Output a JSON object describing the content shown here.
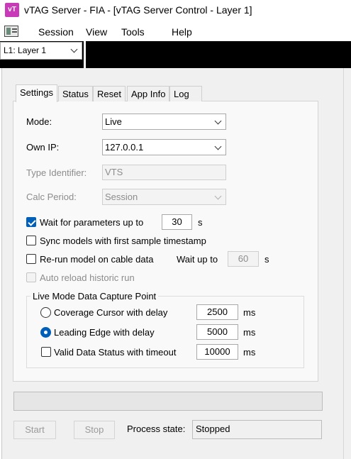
{
  "window": {
    "app_icon_text": "vT",
    "title": "vTAG Server - FIA - [vTAG Server Control - Layer 1]"
  },
  "menu": {
    "items": [
      "Session",
      "View",
      "Tools",
      "Help"
    ]
  },
  "layer_selector": {
    "value": "L1: Layer 1"
  },
  "tabs": [
    {
      "label": "Settings",
      "active": true
    },
    {
      "label": "Status",
      "active": false
    },
    {
      "label": "Reset",
      "active": false
    },
    {
      "label": "App Info",
      "active": false
    },
    {
      "label": "Log",
      "active": false
    }
  ],
  "settings": {
    "mode": {
      "label": "Mode:",
      "value": "Live"
    },
    "own_ip": {
      "label": "Own IP:",
      "value": "127.0.0.1"
    },
    "type_identifier": {
      "label": "Type Identifier:",
      "value": "VTS"
    },
    "calc_period": {
      "label": "Calc Period:",
      "value": "Session"
    },
    "wait_for_params": {
      "label": "Wait for parameters up to",
      "value": "30",
      "unit": "s",
      "checked": true
    },
    "sync_models": {
      "label": "Sync models with first sample timestamp",
      "checked": false
    },
    "rerun_model": {
      "label": "Re-run model on cable data",
      "checked": false,
      "wait_label": "Wait up to",
      "wait_value": "60",
      "wait_unit": "s"
    },
    "auto_reload": {
      "label": "Auto reload historic run",
      "checked": false,
      "disabled": true
    }
  },
  "capture_point": {
    "title": "Live Mode Data Capture Point",
    "options": [
      {
        "label": "Coverage Cursor with delay",
        "value": "2500",
        "unit": "ms",
        "selected": false
      },
      {
        "label": "Leading Edge with delay",
        "value": "5000",
        "unit": "ms",
        "selected": true
      }
    ],
    "valid_data": {
      "label": "Valid Data Status with timeout",
      "value": "10000",
      "unit": "ms",
      "checked": false
    }
  },
  "footer": {
    "start_label": "Start",
    "stop_label": "Stop",
    "process_state_label": "Process state:",
    "process_state_value": "Stopped"
  },
  "colors": {
    "accent": "#005fb8",
    "app_icon": "#c83ab8",
    "panel_bg": "#f0f0f0"
  }
}
